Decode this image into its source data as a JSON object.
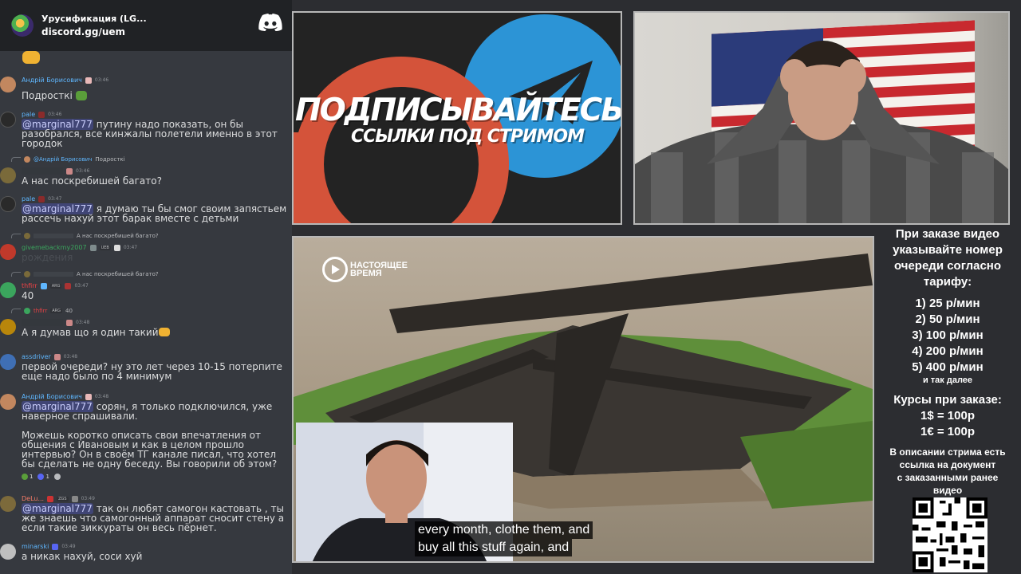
{
  "discord": {
    "server_name": "Урусификация (LG...",
    "invite": "discord.gg/uem",
    "colors": {
      "header": "#202225",
      "background": "#36393f",
      "mention_bg": "#5865f2"
    },
    "messages": [
      {
        "username": "Андрій Борисович",
        "name_color": "#5fb7ff",
        "time": "03:46",
        "avatar": "#c2875f",
        "text": "Подросткі"
      },
      {
        "username": "pale",
        "name_color": "#5fb7ff",
        "time": "03:46",
        "avatar": "#2a2a2a",
        "mention": "@marginal777",
        "text": "путину надо показать, он бы разобрался, все кинжалы полетели именно в этот городок"
      },
      {
        "reply_to": "@Андрій Борисович",
        "reply_text": "Подросткі",
        "time": "03:46",
        "avatar": "#7a6a3a",
        "text": "А нас поскребишей багато?"
      },
      {
        "username": "pale",
        "name_color": "#5fb7ff",
        "time": "03:47",
        "avatar": "#2a2a2a",
        "mention": "@marginal777",
        "text": "я думаю ты бы смог своим запястьем рассечь нахуй этот барак вместе с детьми"
      },
      {
        "reply_text": "А нас поскребишей багато?",
        "username": "givemebackmy2007",
        "name_color": "#3ba55d",
        "badge": "UEB",
        "time": "03:47",
        "avatar": "#c0392b",
        "text": "рождения"
      },
      {
        "reply_text": "А нас поскребишей багато?",
        "username": "thfirr",
        "name_color": "#ed4245",
        "badge": "ARG",
        "time": "03:47",
        "avatar": "#3ba55d",
        "text": "40"
      },
      {
        "reply_text": "40",
        "reply_user": "thfirr",
        "reply_badge": "ARG",
        "time": "03:48",
        "avatar": "#b8860b",
        "text": "А я думав що я один такий"
      },
      {
        "username": "assdriver",
        "name_color": "#5fb7ff",
        "time": "03:48",
        "avatar": "#3f6fb5",
        "text": "первой очереди? ну это лет через 10-15 потерпите еще надо было по 4 минимум"
      },
      {
        "username": "Андрій Борисович",
        "name_color": "#5fb7ff",
        "time": "03:48",
        "avatar": "#c2875f",
        "mention": "@marginal777",
        "text": "сорян, я только подключился, уже наверное спрашивали.",
        "text2": "Можешь коротко описать свои впечатления от общения с Ивановым и как в целом прошло интервью? Он в своём ТГ канале писал, что хотел бы сделать не одну беседу. Вы говорили об этом?",
        "reactions": [
          "1",
          "1",
          ""
        ]
      },
      {
        "username": "DeLu...",
        "name_color": "#f47b67",
        "badge": "ZGS",
        "time": "03:49",
        "avatar": "#7c6a3b",
        "mention": "@marginal777",
        "text": "так он любят самогон кастовать , ты же знаешь что самогонный аппарат сносит стену а если такие зиккураты он весь пёрнет."
      },
      {
        "username": "minarski",
        "name_color": "#5fb7ff",
        "time": "03:49",
        "avatar": "#bfbfbf",
        "text": "а никак нахуй, соси хуй"
      }
    ]
  },
  "banner": {
    "title": "ПОДПИСЫВАЙТЕСЬ",
    "subtitle": "ССЫЛКИ ПОД СТРИМОМ",
    "colors": {
      "patreon": "#d4533a",
      "telegram": "#2c94d6"
    }
  },
  "video": {
    "logo_text_1": "НАСТОЯЩЕЕ",
    "logo_text_2": "ВРЕМЯ",
    "subtitle_line1": "every month, clothe them, and",
    "subtitle_line2": "buy all this stuff again, and"
  },
  "info": {
    "title_lines": [
      "При заказе видео",
      "указывайте номер",
      "очереди согласно",
      "тарифу:"
    ],
    "tariffs": [
      "1) 25 р/мин",
      "2) 50 р/мин",
      "3) 100 р/мин",
      "4) 200 р/мин",
      "5) 400 р/мин"
    ],
    "and_more": "и так далее",
    "rates_title": "Курсы при заказе:",
    "rates": [
      "1$ = 100р",
      "1€ = 100р"
    ],
    "note_lines": [
      "В описании стрима есть",
      "ссылка на документ",
      "с заказанными ранее",
      "видео"
    ]
  }
}
